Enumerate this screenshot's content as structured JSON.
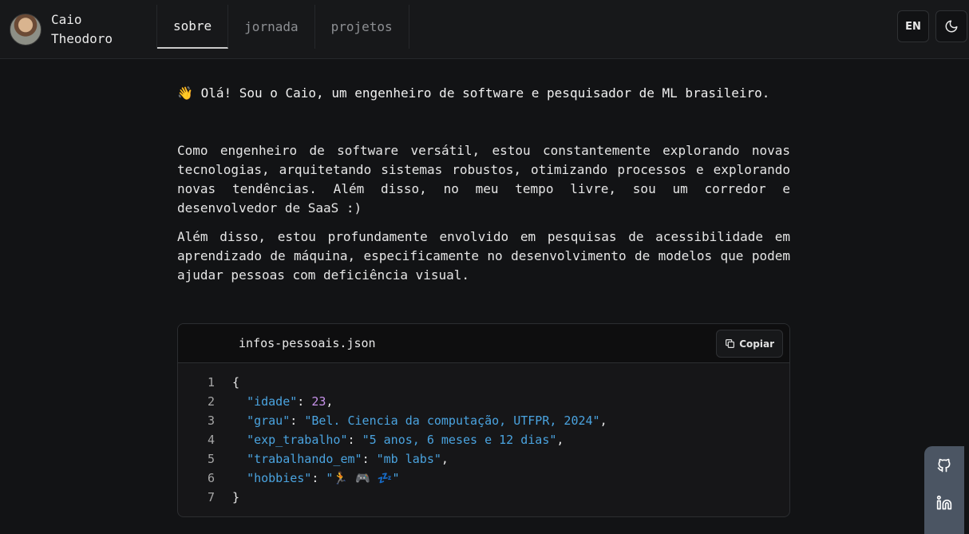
{
  "profile": {
    "name": "Caio Theodoro"
  },
  "nav": {
    "tabs": [
      "sobre",
      "jornada",
      "projetos"
    ],
    "active": 0
  },
  "header": {
    "lang_label": "EN",
    "theme_icon": "moon-icon"
  },
  "intro": {
    "emoji": "👋",
    "text": "Olá! Sou o Caio, um engenheiro de software e pesquisador de ML brasileiro."
  },
  "paragraphs": [
    "Como engenheiro de software versátil, estou constantemente explorando novas tecnologias, arquitetando sistemas robustos, otimizando processos e explorando novas tendências. Além disso, no meu tempo livre, sou um corredor e desenvolvedor de SaaS :)",
    "Além disso, estou profundamente envolvido em pesquisas de acessibilidade em aprendizado de máquina, especificamente no desenvolvimento de modelos que podem ajudar pessoas com deficiência visual."
  ],
  "code": {
    "filename": "infos-pessoais.json",
    "copy_label": "Copiar",
    "line_numbers": [
      "1",
      "2",
      "3",
      "4",
      "5",
      "6",
      "7"
    ],
    "open_brace": "{",
    "close_brace": "}",
    "entries": [
      {
        "key": "\"idade\"",
        "value": "23",
        "type": "number",
        "comma": ","
      },
      {
        "key": "\"grau\"",
        "value": "\"Bel. Ciencia da computação, UTFPR, 2024\"",
        "type": "string",
        "comma": ","
      },
      {
        "key": "\"exp_trabalho\"",
        "value": "\"5 anos, 6 meses e 12 dias\"",
        "type": "string",
        "comma": ","
      },
      {
        "key": "\"trabalhando_em\"",
        "value": "\"mb labs\"",
        "type": "string",
        "comma": ","
      },
      {
        "key": "\"hobbies\"",
        "value": "\"🏃 🎮 💤\"",
        "type": "string",
        "comma": ""
      }
    ]
  },
  "social": {
    "icons": [
      "github-icon",
      "linkedin-icon"
    ]
  },
  "colors": {
    "background": "#121315",
    "json_key": "#4aa3df",
    "json_number": "#c792ea",
    "social_bg": "#4b5563"
  }
}
